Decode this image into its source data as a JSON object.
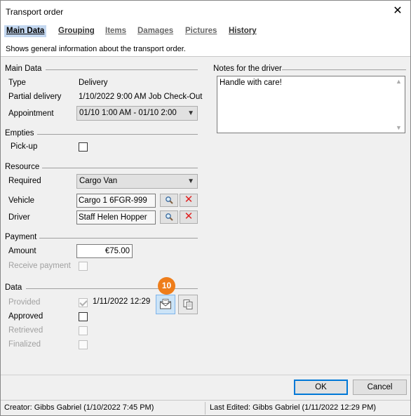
{
  "window": {
    "title": "Transport order",
    "close_glyph": "✕"
  },
  "tabs": [
    {
      "label": "Main Data",
      "active": true
    },
    {
      "label": "Grouping",
      "active": false
    },
    {
      "label": "Items",
      "active": false
    },
    {
      "label": "Damages",
      "active": false
    },
    {
      "label": "Pictures",
      "active": false
    },
    {
      "label": "History",
      "active": false
    }
  ],
  "description": "Shows general information about the transport order.",
  "main_data": {
    "section": "Main Data",
    "type_label": "Type",
    "type_value": "Delivery",
    "partial_label": "Partial delivery",
    "partial_value": "1/10/2022 9:00 AM Job Check-Out",
    "appointment_label": "Appointment",
    "appointment_value": "01/10 1:00 AM - 01/10 2:00"
  },
  "notes": {
    "section": "Notes for the driver",
    "text": "Handle with care!"
  },
  "empties": {
    "section": "Empties",
    "pickup_label": "Pick-up"
  },
  "resource": {
    "section": "Resource",
    "required_label": "Required",
    "required_value": "Cargo Van",
    "vehicle_label": "Vehicle",
    "vehicle_value": "Cargo 1 6FGR-999",
    "driver_label": "Driver",
    "driver_value": "Staff Helen Hopper"
  },
  "payment": {
    "section": "Payment",
    "amount_label": "Amount",
    "amount_value": "€75.00",
    "receive_label": "Receive payment"
  },
  "data": {
    "section": "Data",
    "provided_label": "Provided",
    "provided_value": "1/11/2022 12:29",
    "approved_label": "Approved",
    "retrieved_label": "Retrieved",
    "finalized_label": "Finalized",
    "badge": "10"
  },
  "buttons": {
    "ok": "OK",
    "cancel": "Cancel"
  },
  "status": {
    "creator": "Creator: Gibbs Gabriel (1/10/2022 7:45 PM)",
    "last_edited": "Last Edited:  Gibbs Gabriel (1/11/2022 12:29 PM)"
  },
  "colors": {
    "badge": "#ee7d1a",
    "active_tab": "#c3d7f0",
    "delete": "#e02020",
    "default_button": "#0078d7"
  }
}
